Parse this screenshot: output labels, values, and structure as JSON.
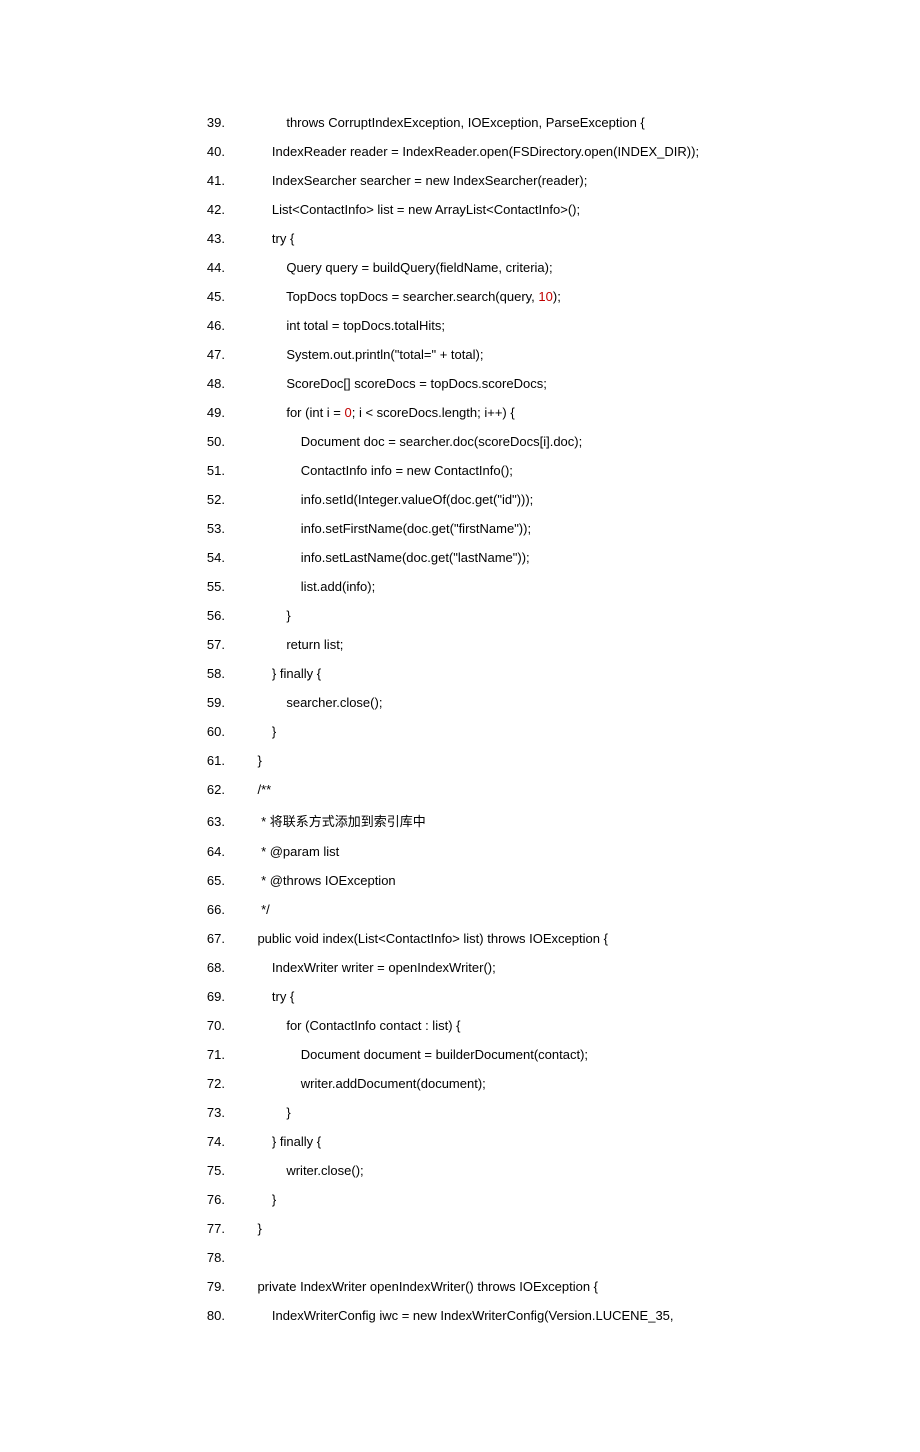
{
  "lines": [
    {
      "n": "39.",
      "indent": 3,
      "segs": [
        {
          "t": "throws CorruptIndexException, IOException, ParseException {  "
        }
      ]
    },
    {
      "n": "40.",
      "indent": 2,
      "segs": [
        {
          "t": "IndexReader reader = IndexReader.open(FSDirectory.open(INDEX_DIR));  "
        }
      ]
    },
    {
      "n": "41.",
      "indent": 2,
      "segs": [
        {
          "t": "IndexSearcher searcher = new IndexSearcher(reader);  "
        }
      ]
    },
    {
      "n": "42.",
      "indent": 2,
      "segs": [
        {
          "t": "List<ContactInfo> list = new ArrayList<ContactInfo>();  "
        }
      ]
    },
    {
      "n": "43.",
      "indent": 2,
      "segs": [
        {
          "t": "try {  "
        }
      ]
    },
    {
      "n": "44.",
      "indent": 3,
      "segs": [
        {
          "t": "Query query = buildQuery(fieldName, criteria);  "
        }
      ]
    },
    {
      "n": "45.",
      "indent": 3,
      "segs": [
        {
          "t": "TopDocs topDocs = searcher.search(query, "
        },
        {
          "t": "10",
          "c": "red"
        },
        {
          "t": ");  "
        }
      ]
    },
    {
      "n": "46.",
      "indent": 3,
      "segs": [
        {
          "t": "int total = topDocs.totalHits;  "
        }
      ]
    },
    {
      "n": "47.",
      "indent": 3,
      "segs": [
        {
          "t": "System.out.println(\"total=\" + total);  "
        }
      ]
    },
    {
      "n": "48.",
      "indent": 3,
      "segs": [
        {
          "t": "ScoreDoc[] scoreDocs = topDocs.scoreDocs;  "
        }
      ]
    },
    {
      "n": "49.",
      "indent": 3,
      "segs": [
        {
          "t": "for (int i = "
        },
        {
          "t": "0",
          "c": "red"
        },
        {
          "t": "; i < scoreDocs.length; i++) {  "
        }
      ]
    },
    {
      "n": "50.",
      "indent": 4,
      "segs": [
        {
          "t": "Document doc = searcher.doc(scoreDocs[i].doc);  "
        }
      ]
    },
    {
      "n": "51.",
      "indent": 4,
      "segs": [
        {
          "t": "ContactInfo info = new ContactInfo();  "
        }
      ]
    },
    {
      "n": "52.",
      "indent": 4,
      "segs": [
        {
          "t": "info.setId(Integer.valueOf(doc.get(\"id\")));  "
        }
      ]
    },
    {
      "n": "53.",
      "indent": 4,
      "segs": [
        {
          "t": "info.setFirstName(doc.get(\"firstName\"));  "
        }
      ]
    },
    {
      "n": "54.",
      "indent": 4,
      "segs": [
        {
          "t": "info.setLastName(doc.get(\"lastName\"));  "
        }
      ]
    },
    {
      "n": "55.",
      "indent": 4,
      "segs": [
        {
          "t": "list.add(info);  "
        }
      ]
    },
    {
      "n": "56.",
      "indent": 3,
      "segs": [
        {
          "t": "}  "
        }
      ]
    },
    {
      "n": "57.",
      "indent": 3,
      "segs": [
        {
          "t": "return list;  "
        }
      ]
    },
    {
      "n": "58.",
      "indent": 2,
      "segs": [
        {
          "t": "} finally {  "
        }
      ]
    },
    {
      "n": "59.",
      "indent": 3,
      "segs": [
        {
          "t": "searcher.close();  "
        }
      ]
    },
    {
      "n": "60.",
      "indent": 2,
      "segs": [
        {
          "t": "}  "
        }
      ]
    },
    {
      "n": "61.",
      "indent": 1,
      "segs": [
        {
          "t": "}  "
        }
      ]
    },
    {
      "n": "62.",
      "indent": 1,
      "segs": [
        {
          "t": "/** "
        }
      ]
    },
    {
      "n": "63.",
      "indent": 1,
      "segs": [
        {
          "t": " * 将联系方式添加到索引库中 "
        }
      ]
    },
    {
      "n": "64.",
      "indent": 1,
      "segs": [
        {
          "t": " * @param list "
        }
      ]
    },
    {
      "n": "65.",
      "indent": 1,
      "segs": [
        {
          "t": " * @throws IOException "
        }
      ]
    },
    {
      "n": "66.",
      "indent": 1,
      "segs": [
        {
          "t": " */  "
        }
      ]
    },
    {
      "n": "67.",
      "indent": 1,
      "segs": [
        {
          "t": "public void index(List<ContactInfo> list) throws IOException {  "
        }
      ]
    },
    {
      "n": "68.",
      "indent": 2,
      "segs": [
        {
          "t": "IndexWriter writer = openIndexWriter();  "
        }
      ]
    },
    {
      "n": "69.",
      "indent": 2,
      "segs": [
        {
          "t": "try {  "
        }
      ]
    },
    {
      "n": "70.",
      "indent": 3,
      "segs": [
        {
          "t": "for (ContactInfo contact : list) {  "
        }
      ]
    },
    {
      "n": "71.",
      "indent": 4,
      "segs": [
        {
          "t": "Document document = builderDocument(contact);  "
        }
      ]
    },
    {
      "n": "72.",
      "indent": 4,
      "segs": [
        {
          "t": "writer.addDocument(document);  "
        }
      ]
    },
    {
      "n": "73.",
      "indent": 3,
      "segs": [
        {
          "t": "}  "
        }
      ]
    },
    {
      "n": "74.",
      "indent": 2,
      "segs": [
        {
          "t": "} finally {  "
        }
      ]
    },
    {
      "n": "75.",
      "indent": 3,
      "segs": [
        {
          "t": "writer.close();  "
        }
      ]
    },
    {
      "n": "76.",
      "indent": 2,
      "segs": [
        {
          "t": "}  "
        }
      ]
    },
    {
      "n": "77.",
      "indent": 1,
      "segs": [
        {
          "t": "}  "
        }
      ]
    },
    {
      "n": "78.",
      "indent": 0,
      "segs": [
        {
          "t": "  "
        }
      ]
    },
    {
      "n": "79.",
      "indent": 1,
      "segs": [
        {
          "t": "private IndexWriter openIndexWriter() throws IOException {  "
        }
      ]
    },
    {
      "n": "80.",
      "indent": 2,
      "segs": [
        {
          "t": "IndexWriterConfig iwc = new IndexWriterConfig(Version.LUCENE_35,  "
        }
      ]
    }
  ],
  "indentUnit": "    "
}
